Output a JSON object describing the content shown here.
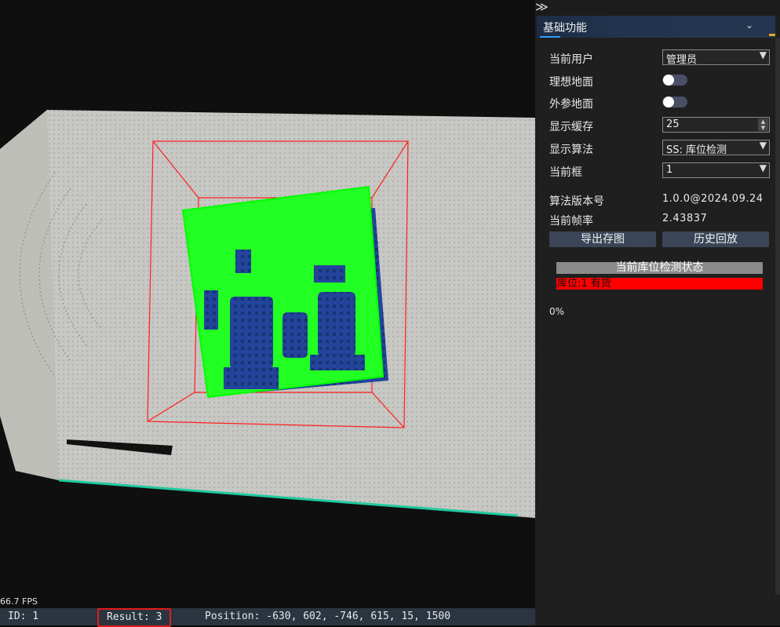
{
  "viewport": {
    "fps": "66.7 FPS"
  },
  "statusbar": {
    "id": "ID: 1",
    "result": "Result: 3",
    "position": "Position: -630, 602, -746, 615, 15, 1500"
  },
  "panel": {
    "collapse_glyph": "≫",
    "header": {
      "title": "基础功能",
      "chevron": "⌄"
    },
    "rows": {
      "user": {
        "label": "当前用户",
        "value": "管理员"
      },
      "ideal_ground": {
        "label": "理想地面",
        "on": false
      },
      "extrinsic_ground": {
        "label": "外参地面",
        "on": false
      },
      "cache": {
        "label": "显示缓存",
        "value": "25"
      },
      "algorithm": {
        "label": "显示算法",
        "value": "SS: 库位检测"
      },
      "frame": {
        "label": "当前框",
        "value": "1"
      }
    },
    "info": {
      "version": {
        "label": "算法版本号",
        "value": "1.0.0@2024.09.24"
      },
      "fps": {
        "label": "当前帧率",
        "value": "2.43837"
      }
    },
    "buttons": {
      "export": "导出存图",
      "history": "历史回放"
    },
    "status": {
      "title": "当前库位检测状态",
      "item": "库位:1 有货"
    },
    "percent": "0%"
  },
  "colors": {
    "accent": "#2f9bff",
    "bbox": "#ff2020",
    "detection": "#00ff00",
    "alert": "#ff0000"
  }
}
